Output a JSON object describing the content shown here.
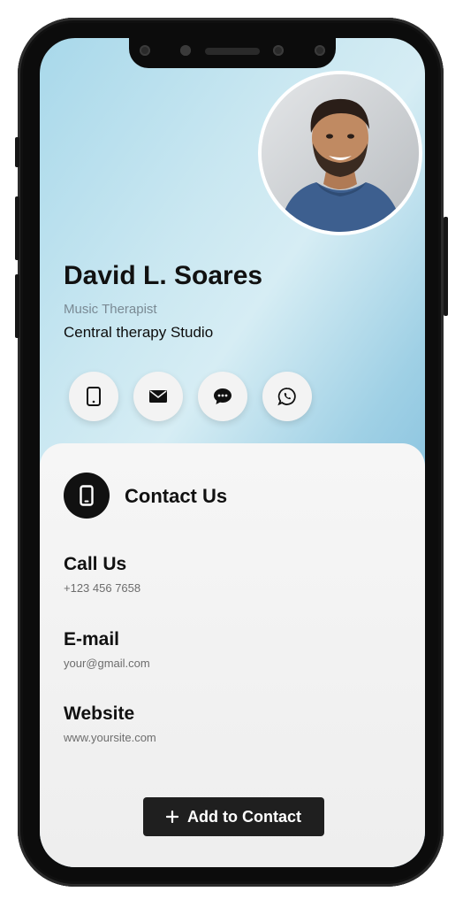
{
  "profile": {
    "name": "David L. Soares",
    "role": "Music Therapist",
    "company": "Central therapy Studio"
  },
  "social": [
    "mobile-phone-icon",
    "envelope-icon",
    "chat-bubble-icon",
    "whatsapp-icon"
  ],
  "contact": {
    "heading": "Contact Us",
    "items": [
      {
        "title": "Call Us",
        "value": "+123 456 7658"
      },
      {
        "title": "E-mail",
        "value": "your@gmail.com"
      },
      {
        "title": "Website",
        "value": "www.yoursite.com"
      }
    ],
    "add_button": "Add to Contact",
    "add_icon": "plus-icon"
  },
  "colors": {
    "accent": "#1f1f1f",
    "gradient_light": "#d6edf4",
    "gradient_dark": "#5aa6d2"
  }
}
